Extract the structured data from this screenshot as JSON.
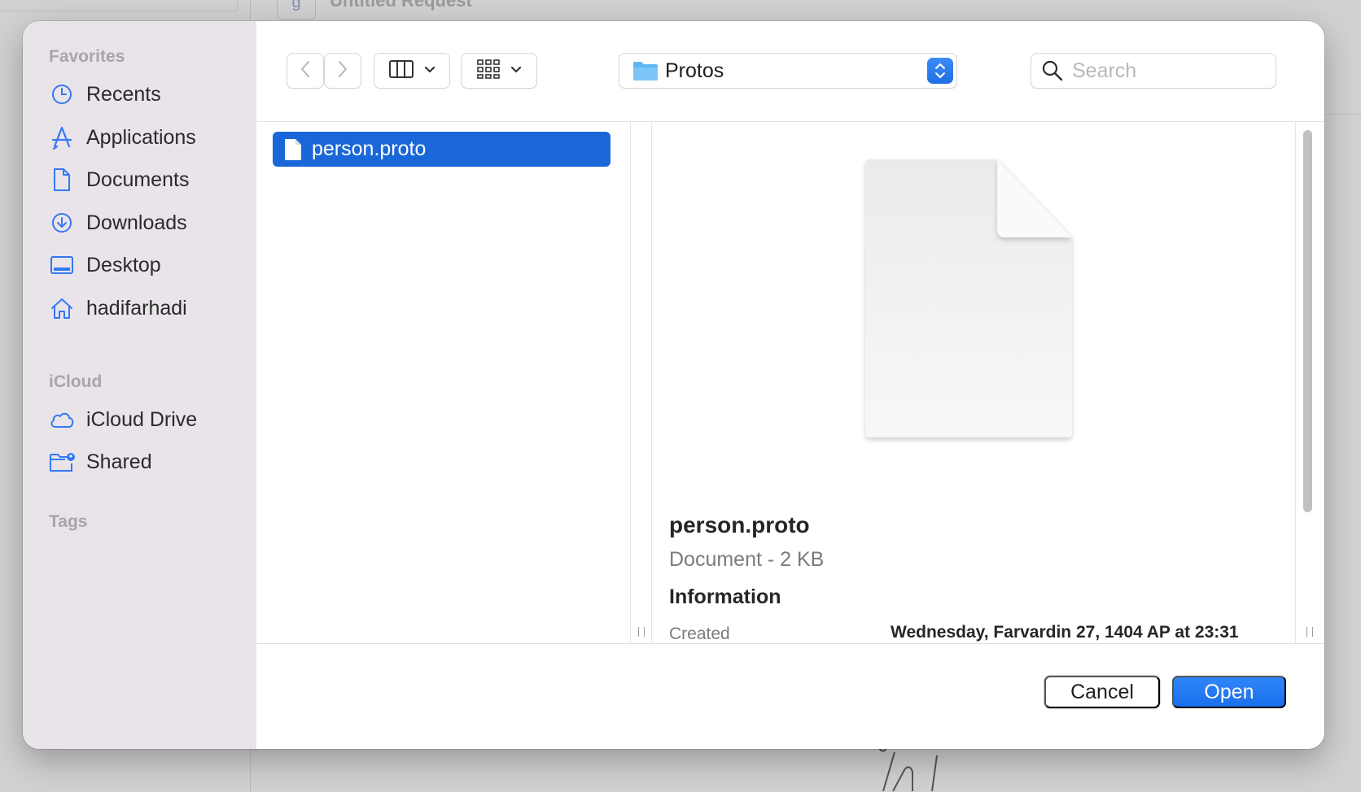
{
  "background": {
    "tab_glyph": "g",
    "tab_title": "Untitled Request"
  },
  "sidebar": {
    "favorites_label": "Favorites",
    "favorites": [
      {
        "label": "Recents",
        "icon": "clock-icon"
      },
      {
        "label": "Applications",
        "icon": "applications-icon"
      },
      {
        "label": "Documents",
        "icon": "document-icon"
      },
      {
        "label": "Downloads",
        "icon": "download-icon"
      },
      {
        "label": "Desktop",
        "icon": "desktop-icon"
      },
      {
        "label": "hadifarhadi",
        "icon": "home-icon"
      }
    ],
    "icloud_label": "iCloud",
    "icloud": [
      {
        "label": "iCloud Drive",
        "icon": "cloud-icon"
      },
      {
        "label": "Shared",
        "icon": "shared-folder-icon"
      }
    ],
    "tags_label": "Tags"
  },
  "toolbar": {
    "location": "Protos",
    "search_placeholder": "Search"
  },
  "browser": {
    "files": [
      {
        "name": "person.proto",
        "selected": true
      }
    ]
  },
  "preview": {
    "name": "person.proto",
    "kind": "Document - 2 KB",
    "info_heading": "Information",
    "created_label": "Created",
    "created_value": "Wednesday, Farvardin 27, 1404 AP at 23:31"
  },
  "footer": {
    "cancel_label": "Cancel",
    "open_label": "Open"
  },
  "colors": {
    "accent": "#1a67d9",
    "sidebar_bg": "#e9e4ea",
    "icon_blue": "#3478f6"
  }
}
